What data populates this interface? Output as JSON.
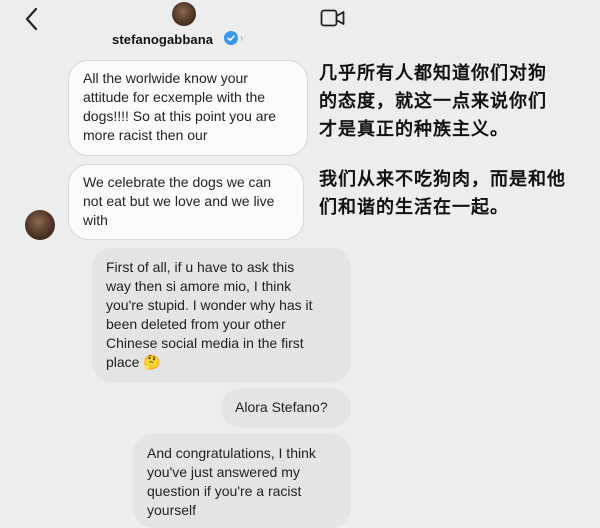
{
  "header": {
    "username": "stefanogabbana",
    "chevron": "›",
    "back_icon": "chevron-left-icon",
    "video_icon": "video-call-icon"
  },
  "messages": [
    {
      "side": "received",
      "text": "All the worlwide know your\nattitude for ecxemple with the\ndogs!!!! So at this point you are\nmore racist then our"
    },
    {
      "side": "received",
      "text": "We celebrate the dogs we can\nnot eat but we love and we live\nwith"
    },
    {
      "side": "sent",
      "text": "First of all, if u have to ask this\nway then si amore mio, I think\nyou're stupid. I wonder why has it\nbeen deleted from your other\nChinese social media in the first\nplace 🤔"
    },
    {
      "side": "sent",
      "text": "Alora Stefano?"
    },
    {
      "side": "sent",
      "text": "And congratulations, I think\nyou've just answered my\nquestion if you're a racist\nyourself"
    }
  ],
  "annotations": [
    "几乎所有人都知道你们对狗\n的态度，就这一点来说你们\n才是真正的种族主义。",
    "我们从来不吃狗肉，而是和他\n们和谐的生活在一起。"
  ],
  "colors": {
    "background": "#ededed",
    "received_bubble": "#fbfbfb",
    "sent_bubble": "#e4e4e4",
    "verified": "#3897f0"
  }
}
